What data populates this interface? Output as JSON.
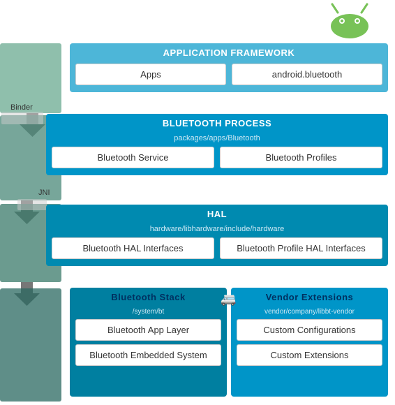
{
  "android_logo": {
    "color_body": "#78C257",
    "color_eye": "#fff"
  },
  "app_framework": {
    "title": "APPLICATION FRAMEWORK",
    "box1": "Apps",
    "box2": "android.bluetooth"
  },
  "binder_label": "Binder",
  "jni_label": "JNI",
  "bt_process": {
    "title": "BLUETOOTH PROCESS",
    "subtitle": "packages/apps/Bluetooth",
    "box1": "Bluetooth Service",
    "box2": "Bluetooth Profiles"
  },
  "hal": {
    "title": "HAL",
    "subtitle": "hardware/libhardware/include/hardware",
    "box1": "Bluetooth HAL Interfaces",
    "box2": "Bluetooth Profile HAL Interfaces"
  },
  "bt_stack": {
    "title": "Bluetooth Stack",
    "subtitle": "/system/bt",
    "box1": "Bluetooth App Layer",
    "box2": "Bluetooth Embedded System"
  },
  "vendor": {
    "title": "Vendor Extensions",
    "subtitle": "vendor/company/libbt-vendor",
    "box1": "Custom Configurations",
    "box2": "Custom Extensions"
  }
}
